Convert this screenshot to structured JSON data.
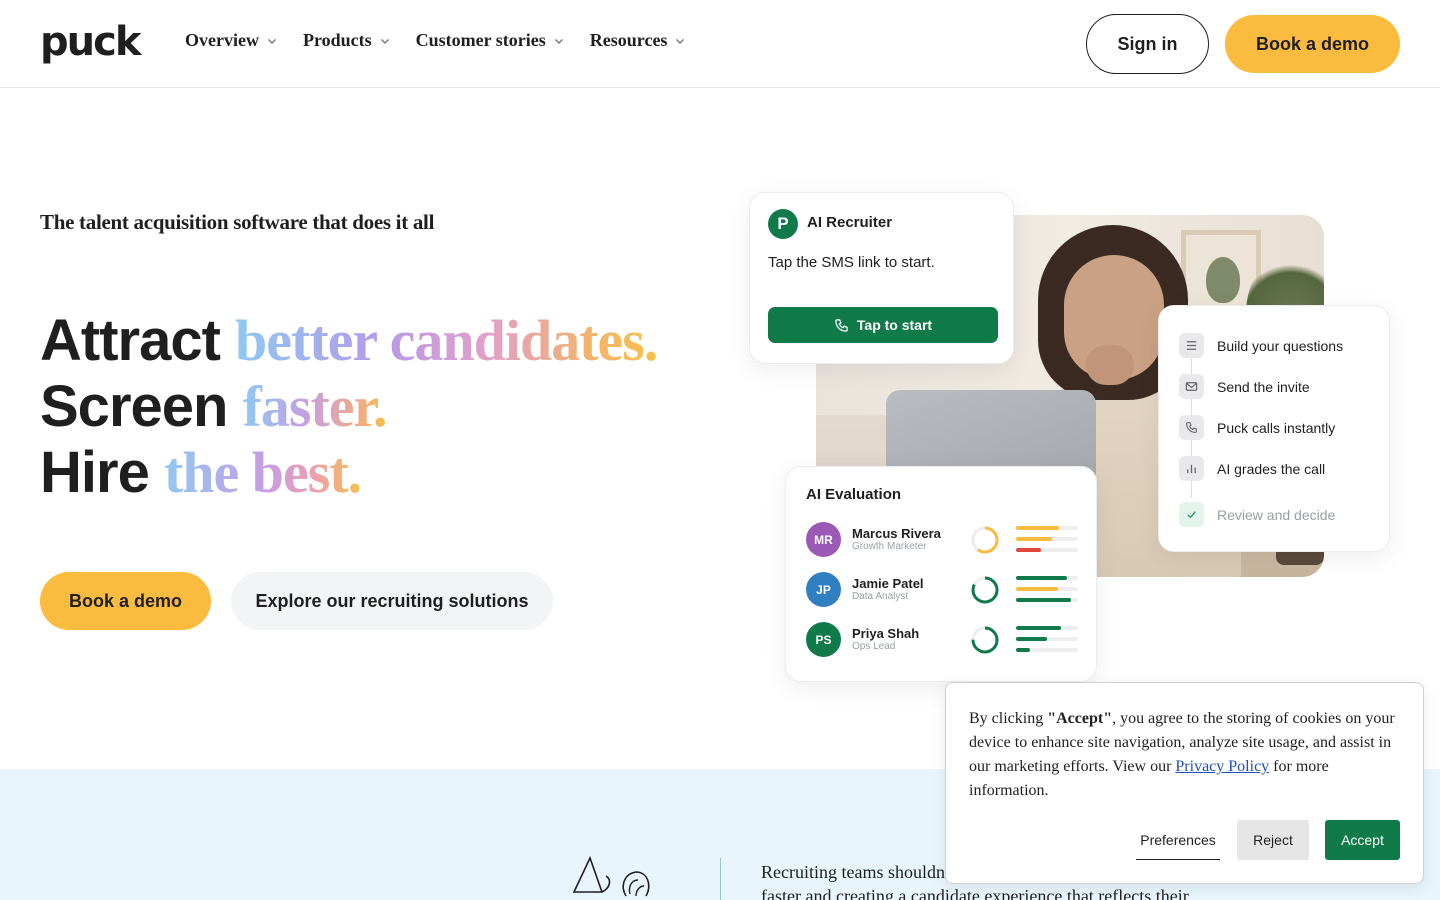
{
  "header": {
    "logo": "puck",
    "nav": [
      {
        "label": "Overview"
      },
      {
        "label": "Products"
      },
      {
        "label": "Customer stories"
      },
      {
        "label": "Resources"
      }
    ],
    "sign_in": "Sign in",
    "book_demo": "Book a demo"
  },
  "hero": {
    "eyebrow": "The talent acquisition software that does it all",
    "line1": {
      "plain": "Attract ",
      "highlight": "better candidates."
    },
    "line2": {
      "plain": "Screen ",
      "highlight": "faster."
    },
    "line3": {
      "plain": "Hire ",
      "highlight": "the best."
    },
    "primary_cta": "Book a demo",
    "secondary_cta": "Explore our recruiting solutions"
  },
  "ai_recruiter": {
    "logo_letter": "P",
    "title": "AI Recruiter",
    "message": "Tap the SMS link to start.",
    "button": "Tap to start"
  },
  "steps": [
    {
      "label": "Build your questions",
      "icon": "list-icon"
    },
    {
      "label": "Send the invite",
      "icon": "mail-icon"
    },
    {
      "label": "Puck calls instantly",
      "icon": "phone-icon"
    },
    {
      "label": "AI grades the call",
      "icon": "bar-chart-icon"
    },
    {
      "label": "Review and decide",
      "icon": "check-icon"
    }
  ],
  "ai_evaluation": {
    "title": "AI Evaluation",
    "candidates": [
      {
        "initials": "MR",
        "name": "Marcus Rivera",
        "role": "Growth Marketer",
        "avatar_color": "#9b59b6",
        "ring_color": "#fbbb3f",
        "ring_fraction": 0.6,
        "bars": [
          {
            "value": 0.7,
            "color": "#fbbb3f"
          },
          {
            "value": 0.58,
            "color": "#fbbb3f"
          },
          {
            "value": 0.4,
            "color": "#e0483e"
          }
        ]
      },
      {
        "initials": "JP",
        "name": "Jamie Patel",
        "role": "Data Analyst",
        "avatar_color": "#2f7fc1",
        "ring_color": "#117a4a",
        "ring_fraction": 0.82,
        "bars": [
          {
            "value": 0.82,
            "color": "#117a4a"
          },
          {
            "value": 0.68,
            "color": "#fbbb3f"
          },
          {
            "value": 0.88,
            "color": "#117a4a"
          }
        ]
      },
      {
        "initials": "PS",
        "name": "Priya Shah",
        "role": "Ops Lead",
        "avatar_color": "#117a4a",
        "ring_color": "#117a4a",
        "ring_fraction": 0.75,
        "bars": [
          {
            "value": 0.72,
            "color": "#117a4a"
          },
          {
            "value": 0.5,
            "color": "#117a4a"
          },
          {
            "value": 0.22,
            "color": "#117a4a"
          }
        ]
      }
    ]
  },
  "band": {
    "text": "Recruiting teams shouldn't"
  },
  "band_text_2": "faster and creating a candidate experience that reflects their",
  "cookie": {
    "prefix": "By clicking ",
    "accept_quoted": "\"Accept\"",
    "middle": ", you agree to the storing of cookies on your device to enhance site navigation, analyze site usage, and assist in our marketing efforts. View our ",
    "privacy_link": "Privacy Policy",
    "suffix": " for more information.",
    "preferences": "Preferences",
    "reject": "Reject",
    "accept": "Accept"
  },
  "colors": {
    "brand_green": "#117a4a",
    "cta_yellow": "#fbbb3f",
    "band_blue": "#e9f5fd"
  }
}
